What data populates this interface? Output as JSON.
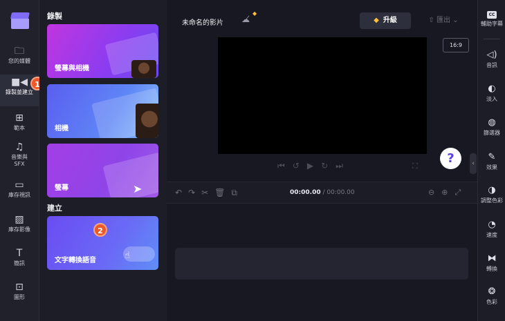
{
  "left_nav": {
    "items": [
      {
        "label": "您的媒體",
        "icon": "folder-icon"
      },
      {
        "label": "錄製並建立",
        "icon": "video-camera-icon"
      },
      {
        "label": "範本",
        "icon": "template-icon"
      },
      {
        "label": "音樂與SFX",
        "icon": "music-note-icon"
      },
      {
        "label": "庫存視訊",
        "icon": "film-icon"
      },
      {
        "label": "庫存影像",
        "icon": "image-icon"
      },
      {
        "label": "簡訊",
        "icon": "text-icon"
      },
      {
        "label": "圖形",
        "icon": "shapes-icon"
      }
    ],
    "active_index": 1,
    "badges": {
      "record": "1",
      "tts": "2"
    }
  },
  "panel": {
    "record_section": "錄製",
    "create_section": "建立",
    "cards": {
      "screen_camera": "螢幕與相機",
      "camera": "相機",
      "screen": "螢幕",
      "tts": "文字轉換語音"
    }
  },
  "editor": {
    "title": "未命名的影片",
    "upgrade_label": "升級",
    "export_label": "匯出",
    "aspect_ratio": "16:9",
    "help_label": "?",
    "timecode_current": "00:00.00",
    "timecode_total": "/ 00:00.00"
  },
  "right_sidebar": {
    "items": [
      {
        "label": "輔助字幕",
        "icon": "captions-icon",
        "glyph": "CC"
      },
      {
        "label": "音訊",
        "icon": "audio-icon"
      },
      {
        "label": "淡入",
        "icon": "fade-icon"
      },
      {
        "label": "篩選器",
        "icon": "filter-icon"
      },
      {
        "label": "效果",
        "icon": "effects-wand-icon"
      },
      {
        "label": "調整色彩",
        "icon": "adjust-colors-icon"
      },
      {
        "label": "速度",
        "icon": "speed-icon"
      },
      {
        "label": "轉換",
        "icon": "transition-icon"
      },
      {
        "label": "色彩",
        "icon": "color-palette-icon"
      }
    ]
  },
  "colors": {
    "accent": "#7e6cf6",
    "badge": "#ec5a2c",
    "gem": "#ffbf3a",
    "background": "#171821"
  }
}
